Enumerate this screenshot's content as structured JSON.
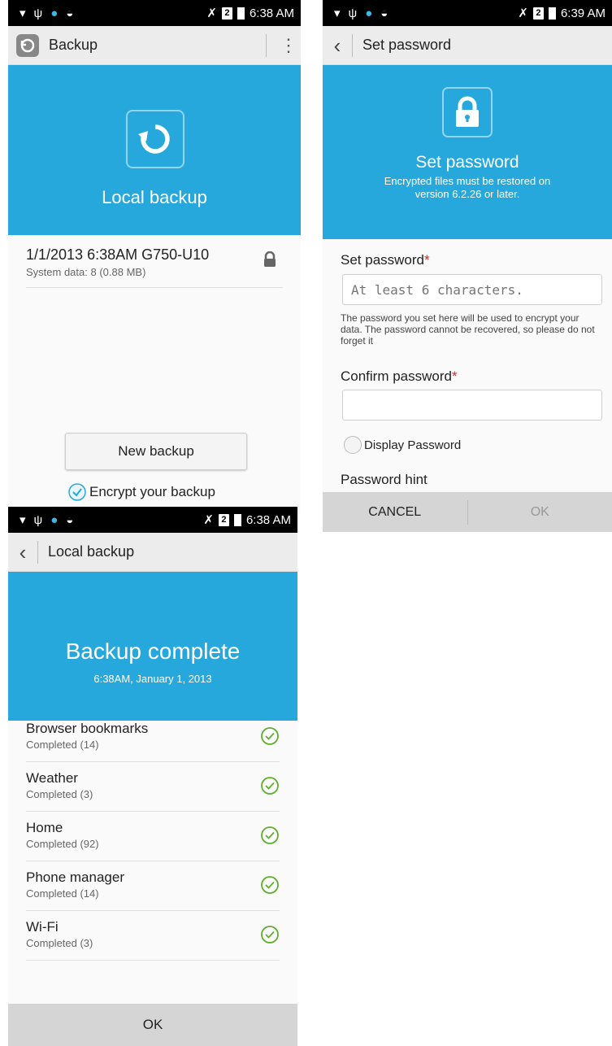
{
  "status": {
    "time_a": "6:38 AM",
    "time_b": "6:39 AM",
    "time_c": "6:38 AM",
    "sim_label": "2"
  },
  "panel_a": {
    "app_title": "Backup",
    "hero_title": "Local backup",
    "backup_item": {
      "title": "1/1/2013 6:38AM G750-U10",
      "subtitle": "System data: 8 (0.88 MB)"
    },
    "new_backup_button": "New backup",
    "encrypt_label": "Encrypt your backup",
    "encrypt_checked": true
  },
  "panel_b": {
    "title": "Set password",
    "hero_title": "Set password",
    "hero_sub_line1": "Encrypted files must be restored on",
    "hero_sub_line2": "version 6.2.26 or later.",
    "set_label": "Set password",
    "required_mark": "*",
    "set_placeholder": "At least 6 characters.",
    "info_text": "The password you set here will be used to encrypt your data. The password cannot be recovered, so please do not forget it",
    "confirm_label": "Confirm password",
    "display_password_label": "Display Password",
    "hint_label": "Password hint",
    "cancel_button": "CANCEL",
    "ok_button": "OK"
  },
  "panel_c": {
    "title": "Local backup",
    "hero_title": "Backup complete",
    "hero_sub": "6:38AM, January 1, 2013",
    "items": [
      {
        "title": "Browser bookmarks",
        "status": "Completed (14)"
      },
      {
        "title": "Weather",
        "status": "Completed (3)"
      },
      {
        "title": "Home",
        "status": "Completed (92)"
      },
      {
        "title": "Phone manager",
        "status": "Completed (14)"
      },
      {
        "title": "Wi-Fi",
        "status": "Completed (3)"
      }
    ],
    "ok_button": "OK"
  },
  "colors": {
    "accent_blue": "#27a8dc",
    "check_green": "#5fae2e",
    "required_red": "#e02020"
  }
}
